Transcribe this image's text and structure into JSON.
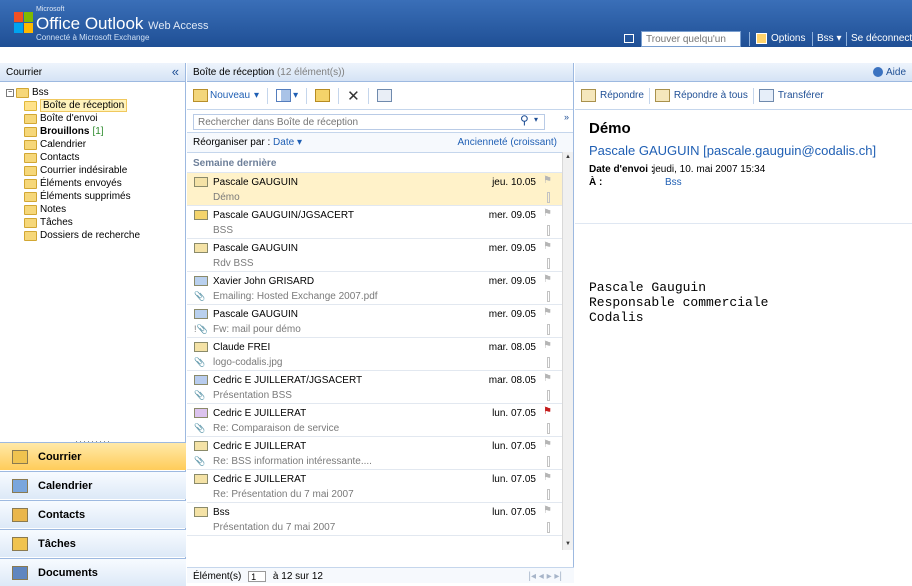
{
  "header": {
    "ms_label": "Microsoft",
    "brand": "Office Outlook",
    "brand_suffix": "Web Access",
    "subtitle": "Connecté à Microsoft Exchange",
    "search_placeholder": "Trouver quelqu'un",
    "options": "Options",
    "mailbox": "Bss ▾",
    "logout": "Se déconnect"
  },
  "nav": {
    "title": "Courrier",
    "tree": {
      "root": "Bss",
      "items": [
        {
          "label": "Boîte de réception",
          "icon": "inbox-icon",
          "selected": true
        },
        {
          "label": "Boîte d'envoi",
          "icon": "outbox-icon"
        },
        {
          "label": "Brouillons",
          "count": "[1]",
          "icon": "drafts-icon"
        },
        {
          "label": "Calendrier",
          "icon": "calendar-icon"
        },
        {
          "label": "Contacts",
          "icon": "contacts-icon"
        },
        {
          "label": "Courrier indésirable",
          "icon": "junk-icon"
        },
        {
          "label": "Éléments envoyés",
          "icon": "sent-icon"
        },
        {
          "label": "Éléments supprimés",
          "icon": "deleted-icon"
        },
        {
          "label": "Notes",
          "icon": "notes-icon"
        },
        {
          "label": "Tâches",
          "icon": "tasks-icon"
        },
        {
          "label": "Dossiers de recherche",
          "icon": "search-folder-icon"
        }
      ]
    },
    "buttons": [
      "Courrier",
      "Calendrier",
      "Contacts",
      "Tâches",
      "Documents"
    ]
  },
  "list": {
    "title": "Boîte de réception",
    "count_text": "(12 élément(s))",
    "new_label": "Nouveau",
    "search_placeholder": "Rechercher dans Boîte de réception",
    "sort_label": "Réorganiser par :",
    "sort_field": "Date ▾",
    "sort_order": "Ancienneté (croissant)",
    "group": "Semaine dernière",
    "messages": [
      {
        "sender": "Pascale GAUGUIN",
        "date": "jeu. 10.05",
        "subject": "Démo",
        "attach": "",
        "flag": "grey",
        "icon": "open-envelope-icon"
      },
      {
        "sender": "Pascale GAUGUIN/JGSACERT",
        "date": "mer. 09.05",
        "subject": "BSS",
        "attach": "",
        "flag": "grey",
        "icon": "meeting-request-icon"
      },
      {
        "sender": "Pascale GAUGUIN",
        "date": "mer. 09.05",
        "subject": "Rdv BSS",
        "attach": "",
        "flag": "grey",
        "icon": "open-envelope-icon"
      },
      {
        "sender": "Xavier John GRISARD",
        "date": "mer. 09.05",
        "subject": "Emailing: Hosted Exchange 2007.pdf",
        "attach": "📎",
        "flag": "grey",
        "icon": "forward-envelope-icon"
      },
      {
        "sender": "Pascale GAUGUIN",
        "date": "mer. 09.05",
        "subject": "Fw: mail pour démo",
        "attach": "!📎",
        "flag": "grey",
        "icon": "forward-envelope-icon"
      },
      {
        "sender": "Claude FREI",
        "date": "mar. 08.05",
        "subject": "logo-codalis.jpg",
        "attach": "📎",
        "flag": "grey",
        "icon": "open-envelope-icon"
      },
      {
        "sender": "Cedric E JUILLERAT/JGSACERT",
        "date": "mar. 08.05",
        "subject": "Présentation BSS",
        "attach": "📎",
        "flag": "grey",
        "icon": "meeting-accepted-icon"
      },
      {
        "sender": "Cedric E JUILLERAT",
        "date": "lun. 07.05",
        "subject": "Re: Comparaison de service",
        "attach": "📎",
        "flag": "red",
        "icon": "replied-envelope-icon"
      },
      {
        "sender": "Cedric E JUILLERAT",
        "date": "lun. 07.05",
        "subject": "Re: BSS information intéressante....",
        "attach": "📎",
        "flag": "grey",
        "icon": "open-envelope-icon"
      },
      {
        "sender": "Cedric E JUILLERAT",
        "date": "lun. 07.05",
        "subject": "Re: Présentation du 7 mai 2007",
        "attach": "",
        "flag": "grey",
        "icon": "open-envelope-icon"
      },
      {
        "sender": "Bss",
        "date": "lun. 07.05",
        "subject": "Présentation du 7 mai 2007",
        "attach": "",
        "flag": "grey",
        "icon": "open-envelope-icon"
      }
    ],
    "footer_label": "Élément(s)",
    "footer_page": "1",
    "footer_range": "à 12 sur 12"
  },
  "reading": {
    "help": "Aide",
    "reply": "Répondre",
    "reply_all": "Répondre à tous",
    "forward": "Transférer",
    "subject": "Démo",
    "from": "Pascale GAUGUIN [pascale.gauguin@codalis.ch]",
    "sent_label": "Date d'envoi :",
    "sent_value": "jeudi, 10. mai 2007 15:34",
    "to_label": "À :",
    "to_value": "Bss",
    "body_lines": [
      "Pascale Gauguin",
      "Responsable commerciale",
      "Codalis"
    ]
  },
  "colors": {
    "topbar": "#2a5ea6",
    "nav_active": "#ffcc5a",
    "selected_row": "#fff2c9",
    "link": "#1f5fb4"
  }
}
